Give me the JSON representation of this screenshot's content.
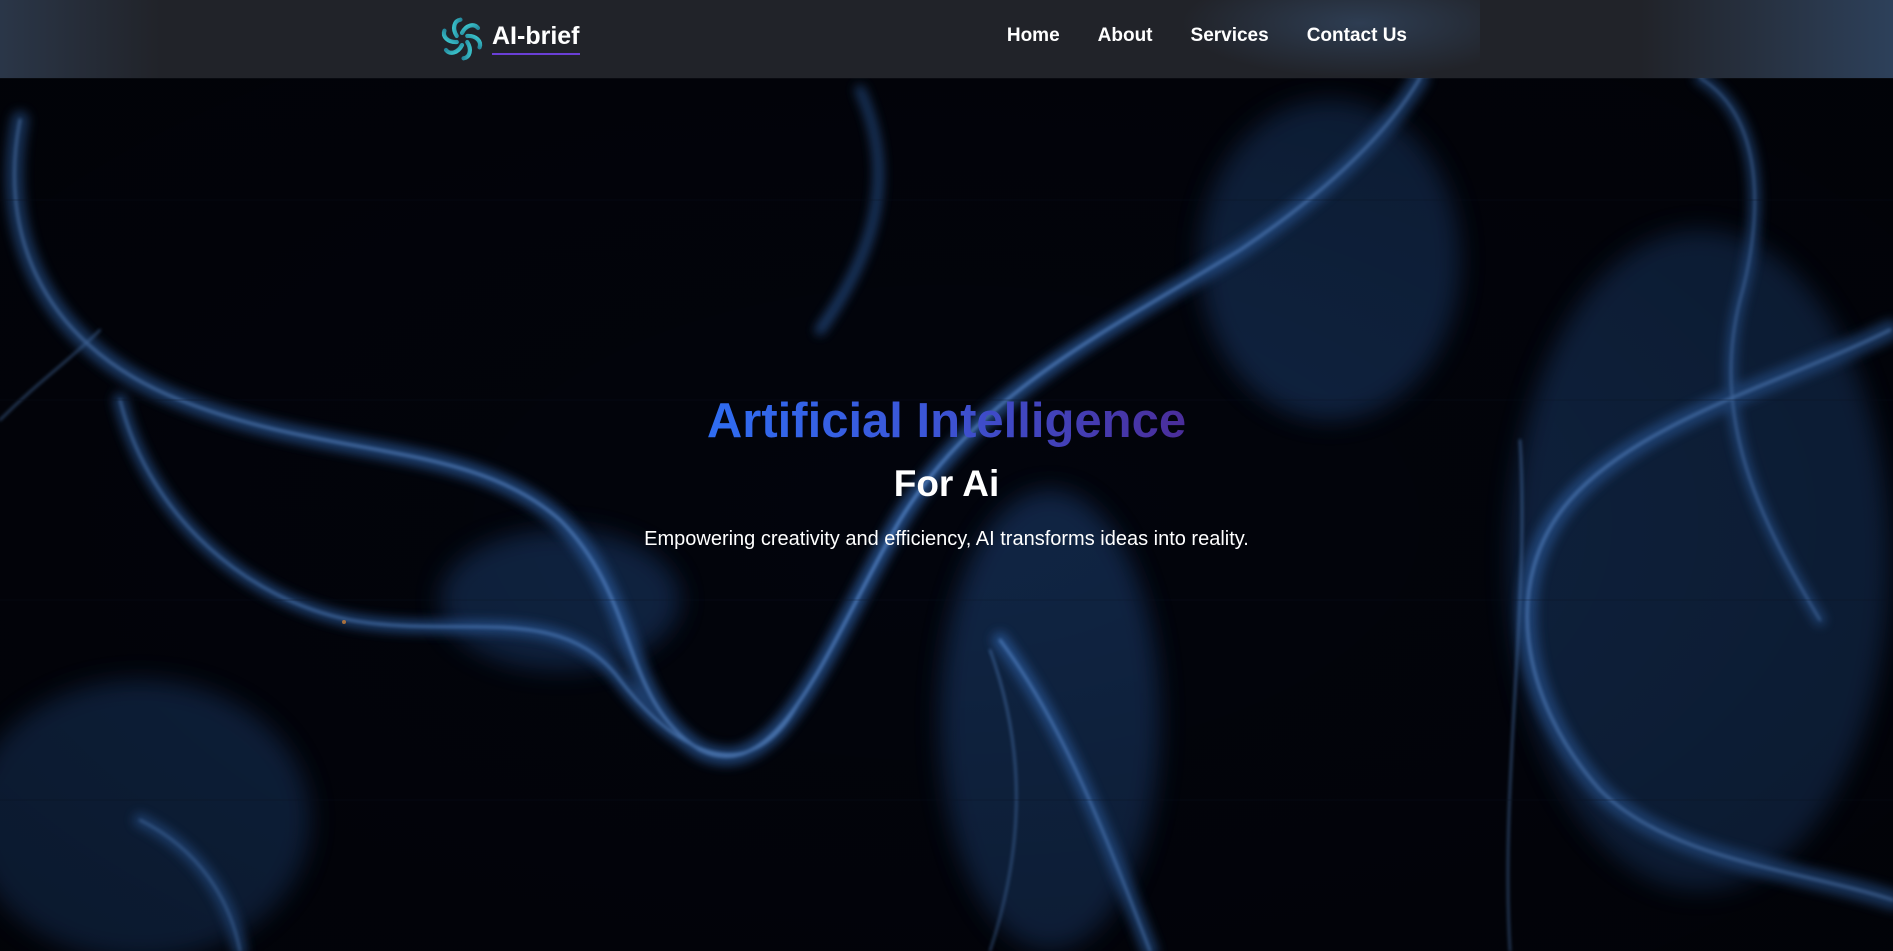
{
  "brand": {
    "name": "AI-brief",
    "logo_icon": "flower-spiral-logo"
  },
  "nav": {
    "items": [
      {
        "label": "Home"
      },
      {
        "label": "About"
      },
      {
        "label": "Services"
      },
      {
        "label": "Contact Us"
      }
    ]
  },
  "hero": {
    "title": "Artificial Intelligence",
    "subtitle": "For Ai",
    "description": "Empowering creativity and efficiency, AI transforms ideas into reality."
  },
  "colors": {
    "navbar": "#22242b",
    "background": "#02040c",
    "smoke": "#3f78c8",
    "title_gradient_start": "#2f6df2",
    "title_gradient_end": "#4a2d9a",
    "accent_underline": "#6a3fd6",
    "text": "#ffffff"
  }
}
